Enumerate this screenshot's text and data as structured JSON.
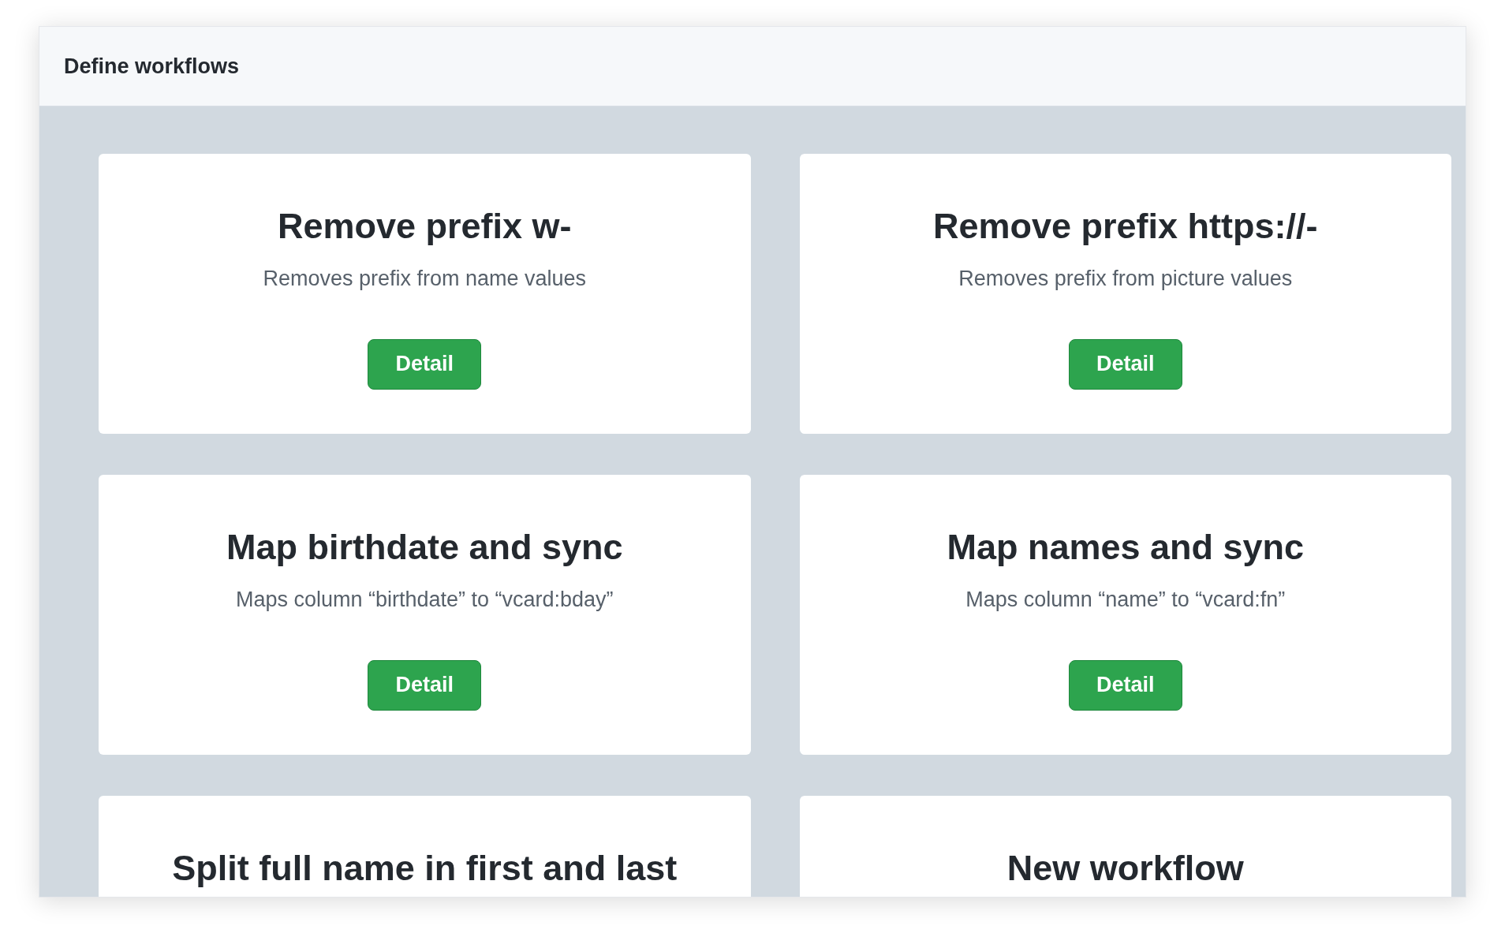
{
  "header": {
    "title": "Define workflows"
  },
  "cards": [
    {
      "title": "Remove prefix w-",
      "description": "Removes prefix from name values",
      "button": "Detail"
    },
    {
      "title": "Remove prefix https://-",
      "description": "Removes prefix from picture values",
      "button": "Detail"
    },
    {
      "title": "Map birthdate and sync",
      "description": "Maps column “birthdate” to “vcard:bday”",
      "button": "Detail"
    },
    {
      "title": "Map names and sync",
      "description": "Maps column “name” to “vcard:fn”",
      "button": "Detail"
    },
    {
      "title": "Split full name in first and last"
    },
    {
      "title": "New workflow"
    }
  ]
}
